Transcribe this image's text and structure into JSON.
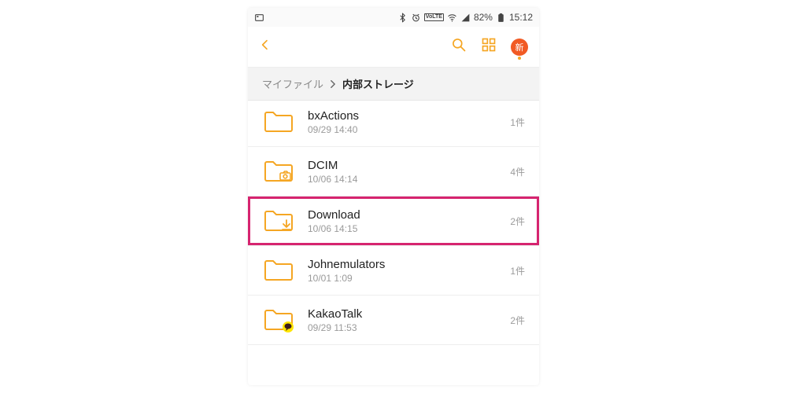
{
  "colors": {
    "accent": "#f5a623",
    "highlight": "#d6246f"
  },
  "statusbar": {
    "battery_pct": "82%",
    "time": "15:12",
    "lte_label": "VoLTE"
  },
  "toolbar": {
    "new_badge_label": "新"
  },
  "breadcrumb": {
    "root": "マイファイル",
    "current": "内部ストレージ"
  },
  "count_suffix": "件",
  "items": [
    {
      "name": "bxActions",
      "ts": "09/29 14:40",
      "count": "1",
      "icon": "folder",
      "highlight": false
    },
    {
      "name": "DCIM",
      "ts": "10/06 14:14",
      "count": "4",
      "icon": "folder-camera",
      "highlight": false
    },
    {
      "name": "Download",
      "ts": "10/06 14:15",
      "count": "2",
      "icon": "folder-download",
      "highlight": true
    },
    {
      "name": "Johnemulators",
      "ts": "10/01 1:09",
      "count": "1",
      "icon": "folder",
      "highlight": false
    },
    {
      "name": "KakaoTalk",
      "ts": "09/29 11:53",
      "count": "2",
      "icon": "folder-kakao",
      "highlight": false
    }
  ]
}
